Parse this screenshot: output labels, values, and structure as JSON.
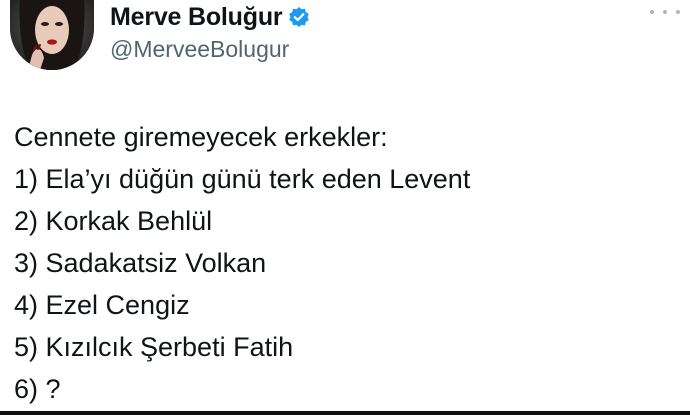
{
  "author": {
    "display_name": "Merve Boluğur",
    "handle": "@MerveeBolugur",
    "verified": true,
    "avatar_icon": "profile-photo",
    "verified_color": "#1d9bf0"
  },
  "menu": {
    "icon": "more-options-icon"
  },
  "tweet": {
    "lines": [
      "Cennete giremeyecek erkekler:",
      "1) Ela’yı düğün günü terk eden Levent",
      "2) Korkak Behlül",
      "3) Sadakatsiz Volkan",
      "4) Ezel Cengiz",
      "5) Kızılcık Şerbeti Fatih",
      "6) ?"
    ]
  }
}
